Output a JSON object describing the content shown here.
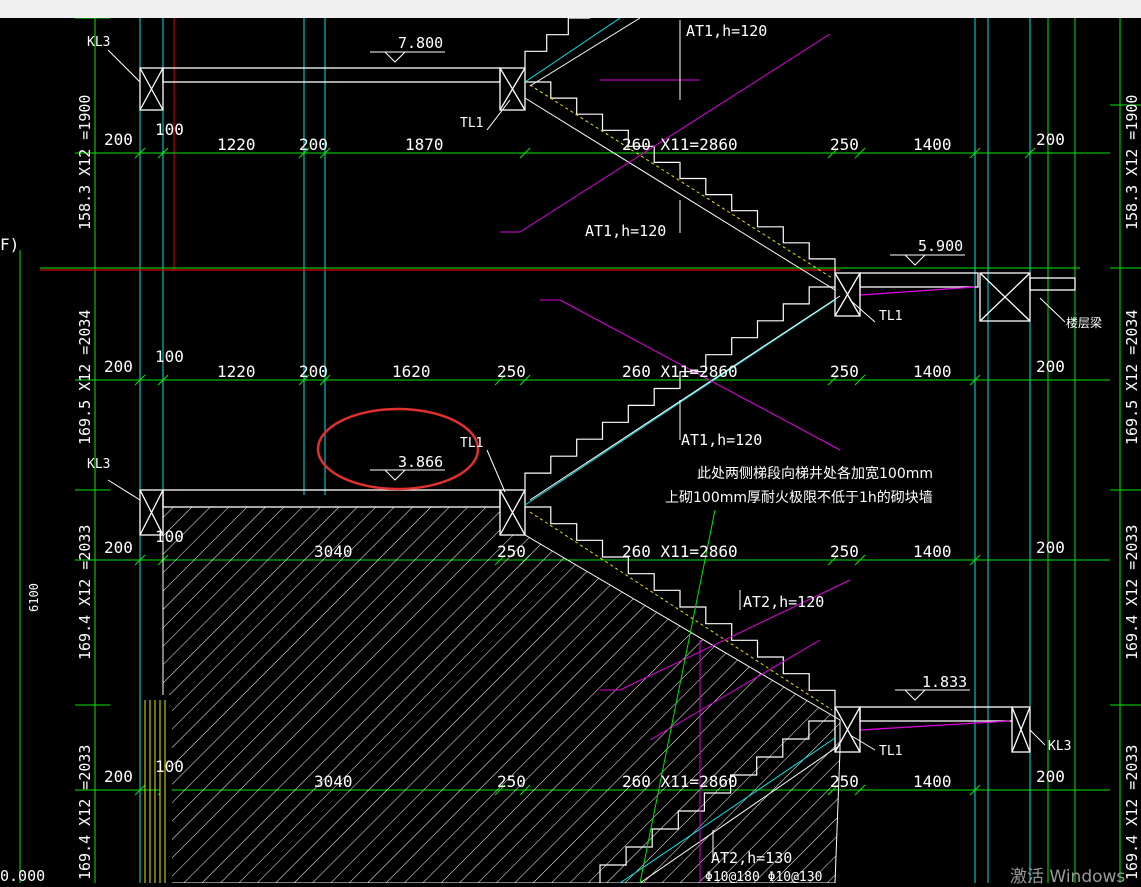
{
  "elevations": [
    "7.800",
    "5.900",
    "3.866",
    "1.833",
    "0.000"
  ],
  "flight_labels": [
    "AT1,h=120",
    "AT1,h=120",
    "AT1,h=120",
    "AT2,h=120",
    "AT2,h=130"
  ],
  "rebar_note": "Φ10@180 Φ10@130",
  "beam_labels": {
    "tl": "TL1",
    "kl": "KL3",
    "floor_beam": "楼层梁"
  },
  "row_dims": [
    [
      "100",
      "1220",
      "200",
      "1870",
      "260 X11=2860",
      "250",
      "1400"
    ],
    [
      "100",
      "1220",
      "200",
      "1620",
      "250",
      "260 X11=2860",
      "250",
      "1400"
    ],
    [
      "100",
      "3040",
      "250",
      "260 X11=2860",
      "250",
      "1400"
    ],
    [
      "100",
      "3040",
      "250",
      "260 X11=2860",
      "250",
      "1400"
    ]
  ],
  "side_200": "200",
  "left_heights": [
    "158.3 X12 =1900",
    "169.5 X12 =2034",
    "169.4 X12 =2033",
    "169.4 X12 =2033"
  ],
  "right_heights": [
    "158.3 X12 =1900",
    "169.5 X12 =2034",
    "169.4 X12 =2033",
    "169.4 X12 =2033"
  ],
  "total_height": "6100",
  "grid_mark": "F)",
  "note_lines": [
    "此处两侧梯段向梯井处各加宽100mm",
    "上砌100mm厚耐火极限不低于1h的砌块墙"
  ],
  "watermark": "激活 Windows",
  "colors": {
    "bg": "#000000",
    "grid": "#00e600",
    "axis": "#e00000",
    "structure": "#ffffff",
    "magenta": "#e000e0",
    "cyan": "#00e5e5",
    "yellow": "#e6e600",
    "annotation": "#e03030"
  }
}
